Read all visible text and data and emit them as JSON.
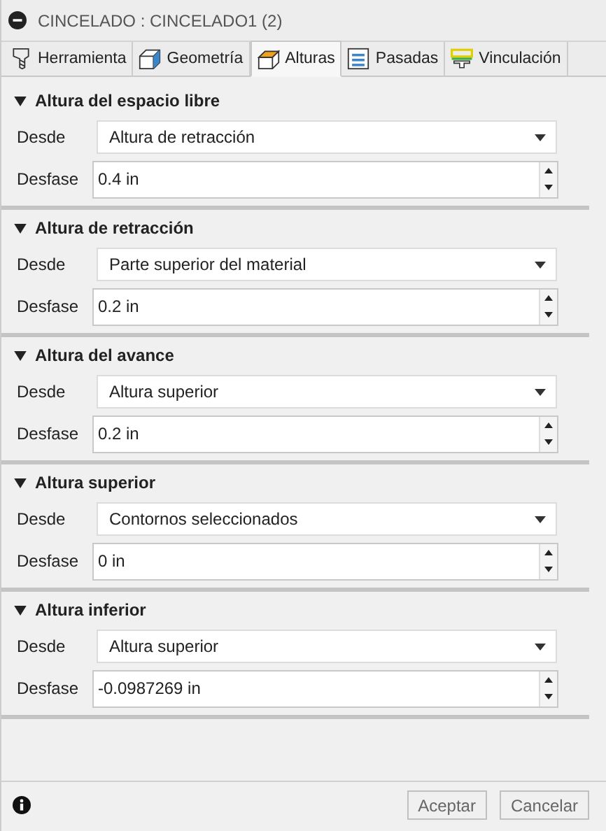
{
  "window": {
    "title": "CINCELADO : CINCELADO1 (2)"
  },
  "tabs": [
    {
      "label": "Herramienta",
      "selected": false
    },
    {
      "label": "Geometría",
      "selected": false
    },
    {
      "label": "Alturas",
      "selected": true
    },
    {
      "label": "Pasadas",
      "selected": false
    },
    {
      "label": "Vinculación",
      "selected": false
    }
  ],
  "sections": [
    {
      "title": "Altura del espacio libre",
      "expanded": true,
      "from_label": "Desde",
      "from": "Altura de retracción",
      "offset_label": "Desfase",
      "offset": "0.4 in"
    },
    {
      "title": "Altura de retracción",
      "expanded": true,
      "from_label": "Desde",
      "from": "Parte superior del material",
      "offset_label": "Desfase",
      "offset": "0.2 in"
    },
    {
      "title": "Altura del avance",
      "expanded": true,
      "from_label": "Desde",
      "from": "Altura superior",
      "offset_label": "Desfase",
      "offset": "0.2 in"
    },
    {
      "title": "Altura superior",
      "expanded": true,
      "from_label": "Desde",
      "from": "Contornos seleccionados",
      "offset_label": "Desfase",
      "offset": "0 in"
    },
    {
      "title": "Altura inferior",
      "expanded": true,
      "from_label": "Desde",
      "from": "Altura superior",
      "offset_label": "Desfase",
      "offset": "-0.0987269 in"
    }
  ],
  "buttons": [
    {
      "label": "Aceptar"
    },
    {
      "label": "Cancelar"
    }
  ]
}
